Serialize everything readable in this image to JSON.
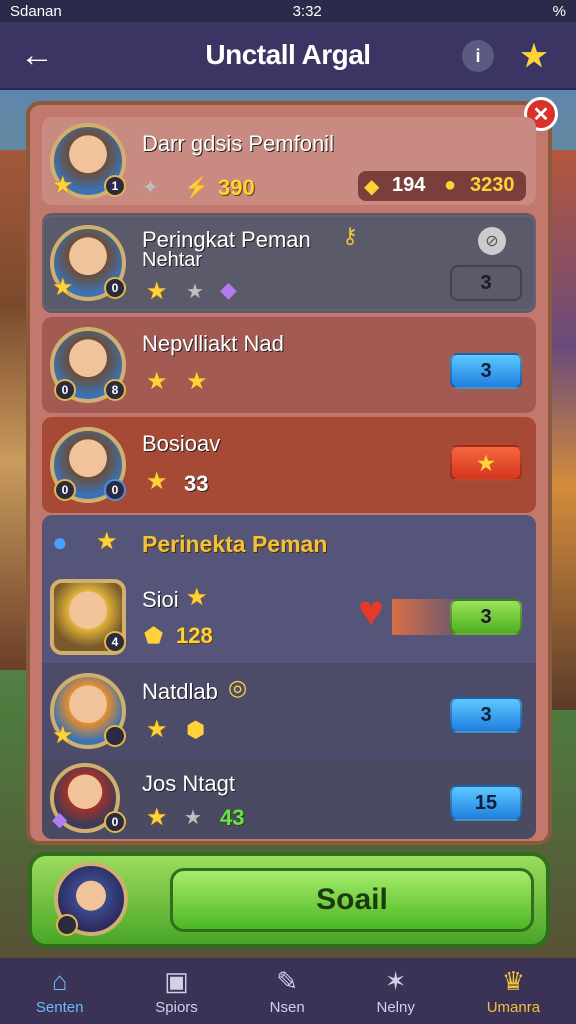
{
  "status": {
    "carrier": "Sdanan",
    "time": "3:32",
    "battery": "%"
  },
  "header": {
    "title": "Unctall Argal"
  },
  "top_player": {
    "name": "Darr gdsis Pemfonil",
    "score": "390",
    "coins_a": "194",
    "coins_b": "3230",
    "badge": "1"
  },
  "rows": [
    {
      "name": "Peringkat Peman",
      "sub": "Nehtar",
      "badge_r": "0",
      "btn": "3",
      "btn_color": "green"
    },
    {
      "name": "Nepvlliakt Nad",
      "badge_l": "0",
      "badge_r": "8",
      "btn": "3",
      "btn_color": "blue"
    },
    {
      "name": "Bosioav",
      "badge_l": "0",
      "badge_r": "0",
      "value": "33",
      "btn": "★",
      "btn_color": "red"
    }
  ],
  "section": {
    "title": "Perinekta Peman"
  },
  "section_rows": [
    {
      "name": "Sioi",
      "value": "128",
      "badge": "4",
      "btn": "3",
      "btn_color": "green"
    },
    {
      "name": "Natdlab",
      "btn": "3",
      "btn_color": "blue"
    },
    {
      "name": "Jos Ntagt",
      "value": "43",
      "badge": "0",
      "btn": "15",
      "btn_color": "blue"
    }
  ],
  "main_button": {
    "label": "Soail"
  },
  "nav": [
    {
      "label": "Senten"
    },
    {
      "label": "Spiors"
    },
    {
      "label": "Nsen"
    },
    {
      "label": "Nelny"
    },
    {
      "label": "Umanra"
    }
  ]
}
